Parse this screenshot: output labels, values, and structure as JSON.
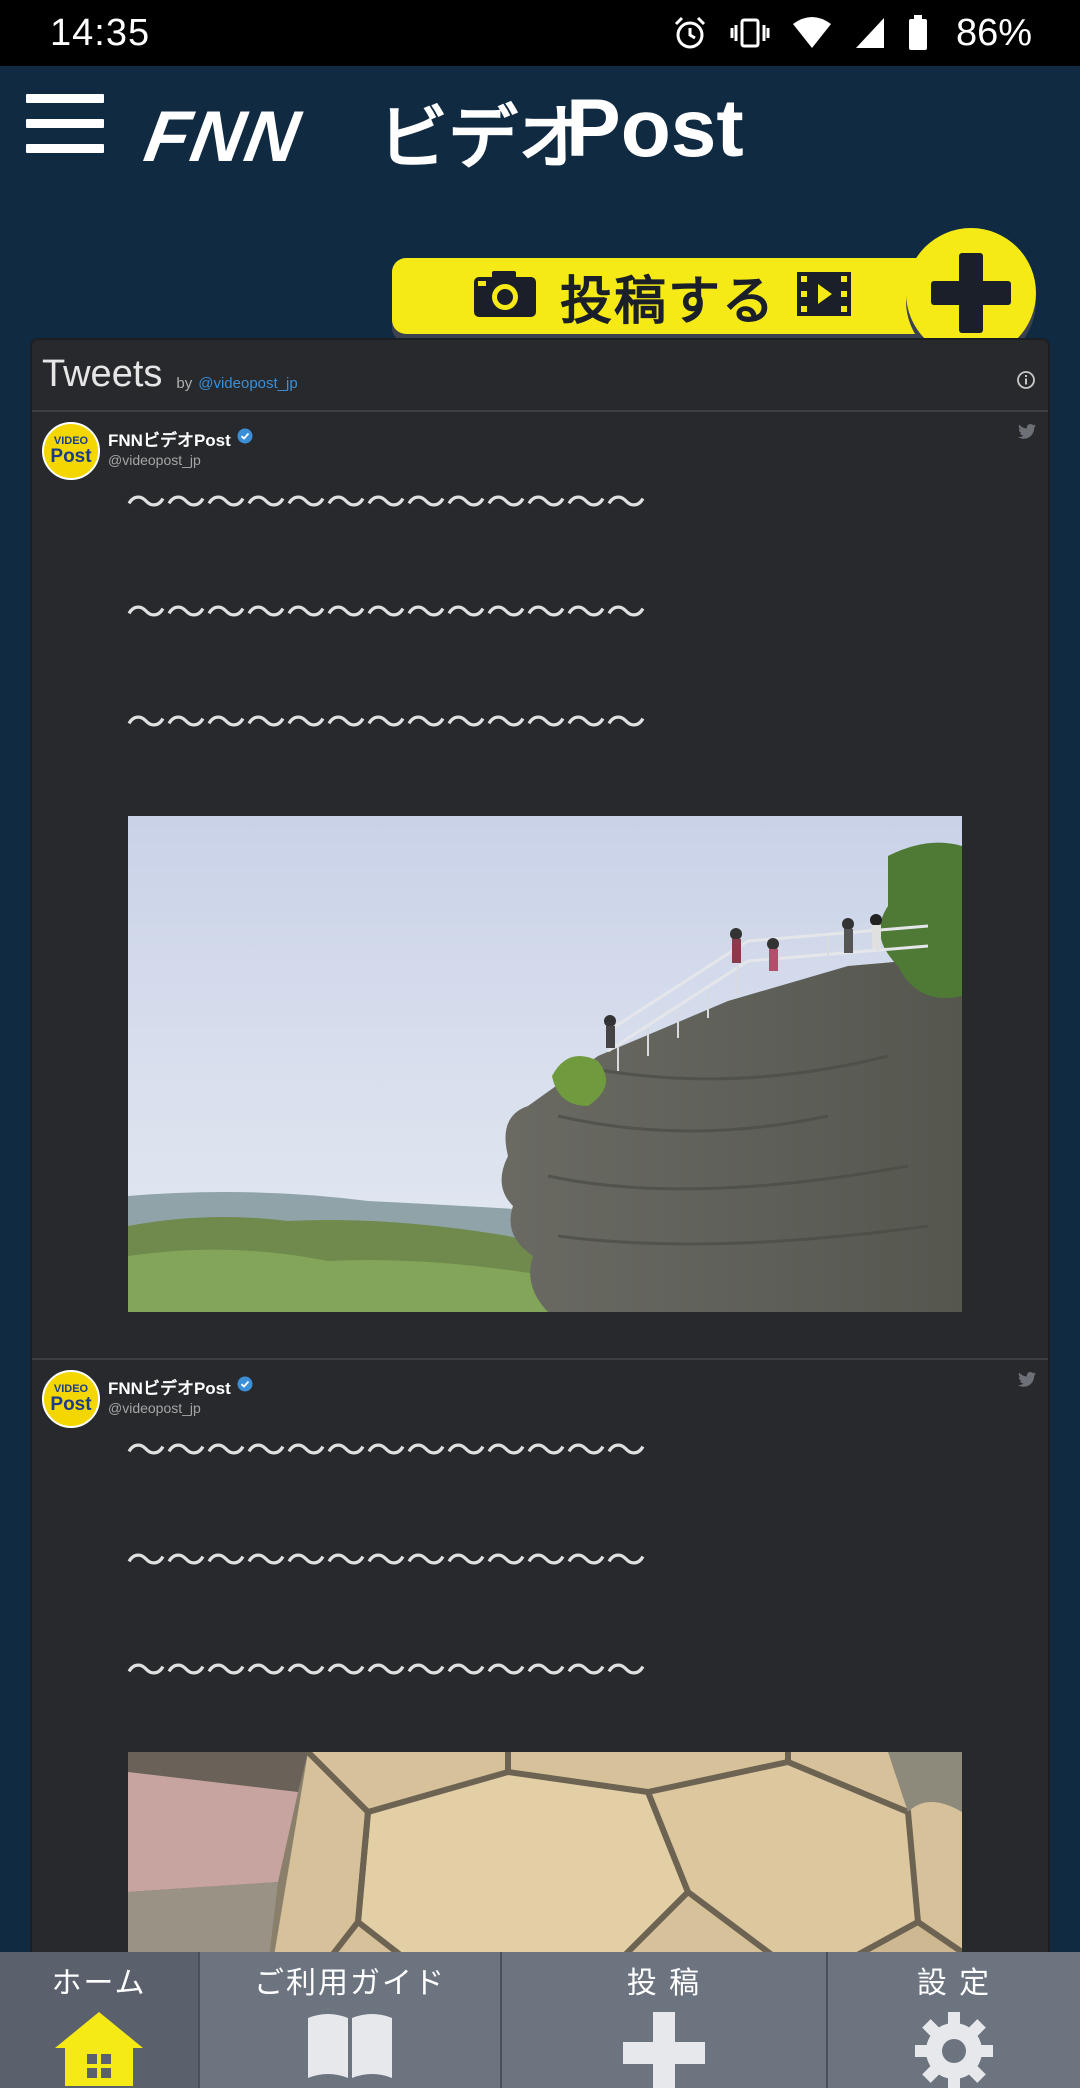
{
  "status_bar": {
    "time": "14:35",
    "battery": "86%",
    "icons": [
      "alarm-icon",
      "vibrate-icon",
      "wifi-icon",
      "signal-icon",
      "battery-icon"
    ]
  },
  "header": {
    "logo_fnn": "FNN",
    "logo_video": "ビデオ",
    "logo_post": "Post",
    "post_button_label": "投稿する"
  },
  "tweets": {
    "title": "Tweets",
    "by": "by",
    "handle": "@videopost_jp",
    "items": [
      {
        "author": "FNNビデオPost",
        "handle": "@videopost_jp",
        "avatar_top": "VIDEO",
        "avatar_bottom": "Post",
        "lines": [
          "〜〜〜〜〜〜〜〜〜〜〜〜〜",
          "〜〜〜〜〜〜〜〜〜〜〜〜〜",
          "〜〜〜〜〜〜〜〜〜〜〜〜〜"
        ],
        "image": "cliff-landscape-photo"
      },
      {
        "author": "FNNビデオPost",
        "handle": "@videopost_jp",
        "avatar_top": "VIDEO",
        "avatar_bottom": "Post",
        "lines": [
          "〜〜〜〜〜〜〜〜〜〜〜〜〜",
          "〜〜〜〜〜〜〜〜〜〜〜〜〜",
          "〜〜〜〜〜〜〜〜〜〜〜〜〜"
        ],
        "image": "tortoise-shell-photo"
      }
    ]
  },
  "bottom_nav": {
    "home": "ホーム",
    "guide": "ご利用ガイド",
    "post": "投 稿",
    "settings": "設 定"
  },
  "colors": {
    "background": "#102a42",
    "accent_yellow": "#f5ea16",
    "widget_bg": "#27292d",
    "nav_bg": "#6c7480",
    "link_blue": "#3b8fd6"
  }
}
